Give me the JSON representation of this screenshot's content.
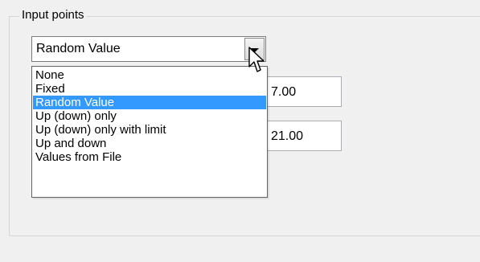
{
  "groupbox": {
    "label": "Input points"
  },
  "combo": {
    "value": "Random Value",
    "button_icon": "dropdown-arrow-icon"
  },
  "dropdown": {
    "options": [
      "None",
      "Fixed",
      "Random Value",
      "Up (down) only",
      "Up (down) only with limit",
      "Up and down",
      "Values from File"
    ],
    "selected_index": 2
  },
  "textboxes": [
    "7.00",
    "21.00"
  ],
  "colors": {
    "selection": "#3399ff",
    "window": "#f0f0f0"
  },
  "cursor": "arrow-cursor-icon"
}
